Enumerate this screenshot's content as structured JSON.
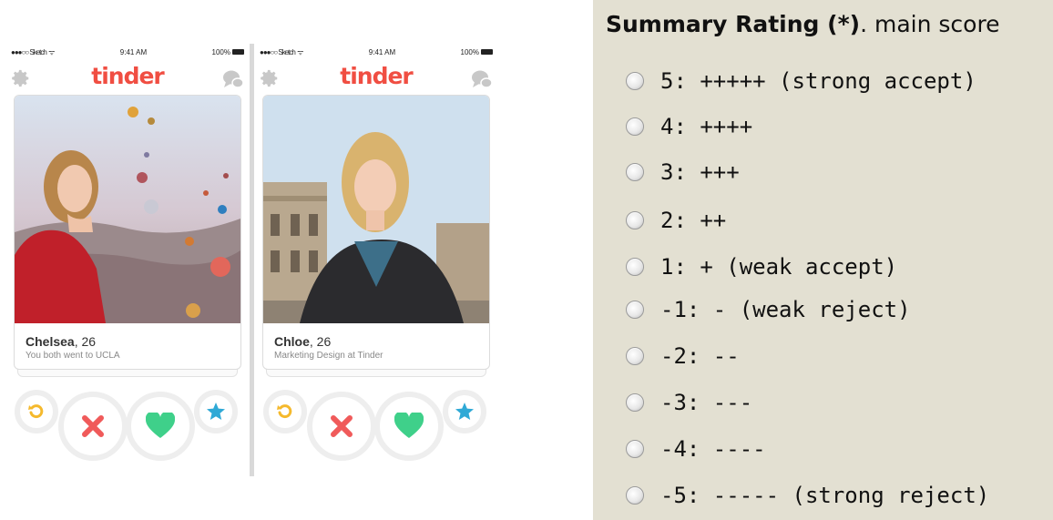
{
  "phones": [
    {
      "status": {
        "carrier": "●●●○○ Sketch",
        "wifi": "ᯤ",
        "time": "9:41 AM",
        "battery": "100%"
      },
      "brand": "tinder",
      "card": {
        "name": "Chelsea",
        "age": ", 26",
        "subtitle": "You both went to UCLA"
      },
      "photo_theme": "hot-air-balloons"
    },
    {
      "status": {
        "carrier": "●●●○○ Sketch",
        "wifi": "ᯤ",
        "time": "9:41 AM",
        "battery": "100%"
      },
      "brand": "tinder",
      "card": {
        "name": "Chloe",
        "age": ", 26",
        "subtitle": "Marketing Design at Tinder"
      },
      "photo_theme": "louvre-courtyard"
    }
  ],
  "action_icons": [
    "undo-icon",
    "nope-x-icon",
    "like-heart-icon",
    "super-like-star-icon"
  ],
  "colors": {
    "brand_red": "#f04e42",
    "nope": "#f05a5a",
    "like": "#3fd08a",
    "undo": "#f5b92c",
    "superlike": "#2fa9d6",
    "panel_bg": "#e3e0d2"
  },
  "rating": {
    "title_bold": "Summary Rating (*)",
    "title_rest": ". main score",
    "options": [
      "5: +++++ (strong accept)",
      "4: ++++",
      "3: +++",
      "2: ++",
      "1: + (weak accept)",
      "-1: - (weak reject)",
      "-2: --",
      "-3: ---",
      "-4: ----",
      "-5: ----- (strong reject)"
    ]
  }
}
